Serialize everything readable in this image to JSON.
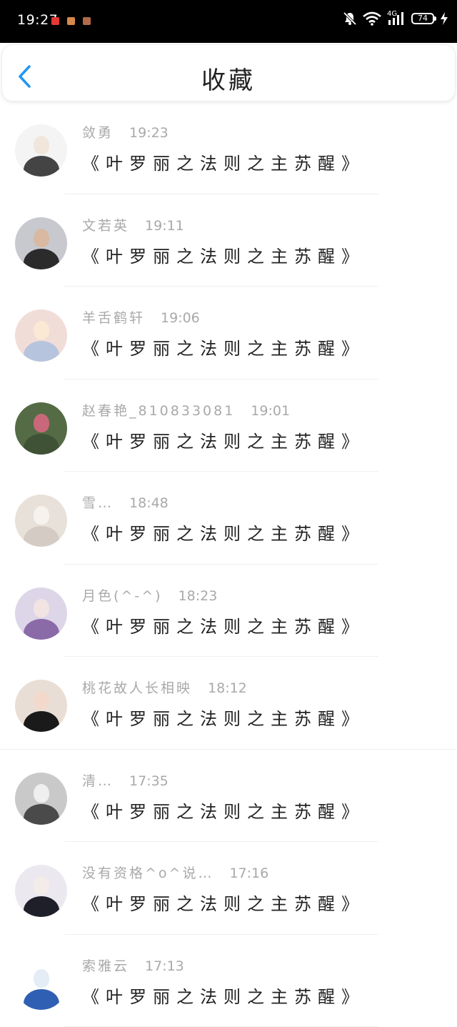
{
  "status_bar": {
    "time": "19:27",
    "app_icons": [
      "red-app-icon",
      "orange-app-icon",
      "brown-app-icon"
    ],
    "app_colors": [
      "#e53935",
      "#d4884a",
      "#b26a4a"
    ],
    "network_label": "4G",
    "battery": "74",
    "icons": [
      "mute-icon",
      "wifi-icon",
      "signal-icon",
      "battery-icon",
      "charging-icon"
    ]
  },
  "header": {
    "title": "收藏",
    "back_icon": "chevron-left-icon",
    "accent_color": "#2196f3"
  },
  "items": [
    {
      "user": "敛勇",
      "time": "19:23",
      "title": "《叶罗丽之法则之主苏醒》",
      "avatar": "manga-boy-avatar",
      "colors": [
        "#f4f4f4",
        "#f0e6dc",
        "#444444"
      ]
    },
    {
      "user": "文若英",
      "time": "19:11",
      "title": "《叶罗丽之法则之主苏醒》",
      "avatar": "woman-photo-avatar",
      "colors": [
        "#c7c9cf",
        "#d9b9a2",
        "#2b2b2b"
      ]
    },
    {
      "user": "羊舌鹤轩",
      "time": "19:06",
      "title": "《叶罗丽之法则之主苏醒》",
      "avatar": "anime-girl-avatar",
      "colors": [
        "#f1ddd8",
        "#fbe9d5",
        "#b7c4dd"
      ]
    },
    {
      "user": "赵春艳_810833081",
      "time": "19:01",
      "title": "《叶罗丽之法则之主苏醒》",
      "avatar": "flowers-avatar",
      "colors": [
        "#556b45",
        "#c9687a",
        "#3f5236"
      ]
    },
    {
      "user": "雪…",
      "time": "18:48",
      "title": "《叶罗丽之法则之主苏醒》",
      "avatar": "cat-avatar",
      "colors": [
        "#e8e1da",
        "#f6f2ee",
        "#d4ccc4"
      ]
    },
    {
      "user": "月色(^-^)",
      "time": "18:23",
      "title": "《叶罗丽之法则之主苏醒》",
      "avatar": "purple-anime-avatar",
      "colors": [
        "#ddd6e8",
        "#f3e4e4",
        "#8b6aa8"
      ]
    },
    {
      "user": "桃花故人长相映",
      "time": "18:12",
      "title": "《叶罗丽之法则之主苏醒》",
      "avatar": "girl-selfie-avatar",
      "colors": [
        "#e9ded5",
        "#f3d9cc",
        "#1a1a1a"
      ]
    },
    {
      "user": "清…",
      "time": "17:35",
      "title": "《叶罗丽之法则之主苏醒》",
      "avatar": "headphone-anime-avatar",
      "colors": [
        "#c9c9c9",
        "#efefef",
        "#4a4a4a"
      ]
    },
    {
      "user": "没有资格^o^说…",
      "time": "17:16",
      "title": "《叶罗丽之法则之主苏醒》",
      "avatar": "dark-anime-avatar",
      "colors": [
        "#ebe8ef",
        "#f4ece8",
        "#1f1f2a"
      ]
    },
    {
      "user": "索雅云",
      "time": "17:13",
      "title": "《叶罗丽之法则之主苏醒》",
      "avatar": "blue-anime-avatar",
      "colors": [
        "#ffffff",
        "#e4ecf6",
        "#2f5fb3"
      ]
    }
  ]
}
